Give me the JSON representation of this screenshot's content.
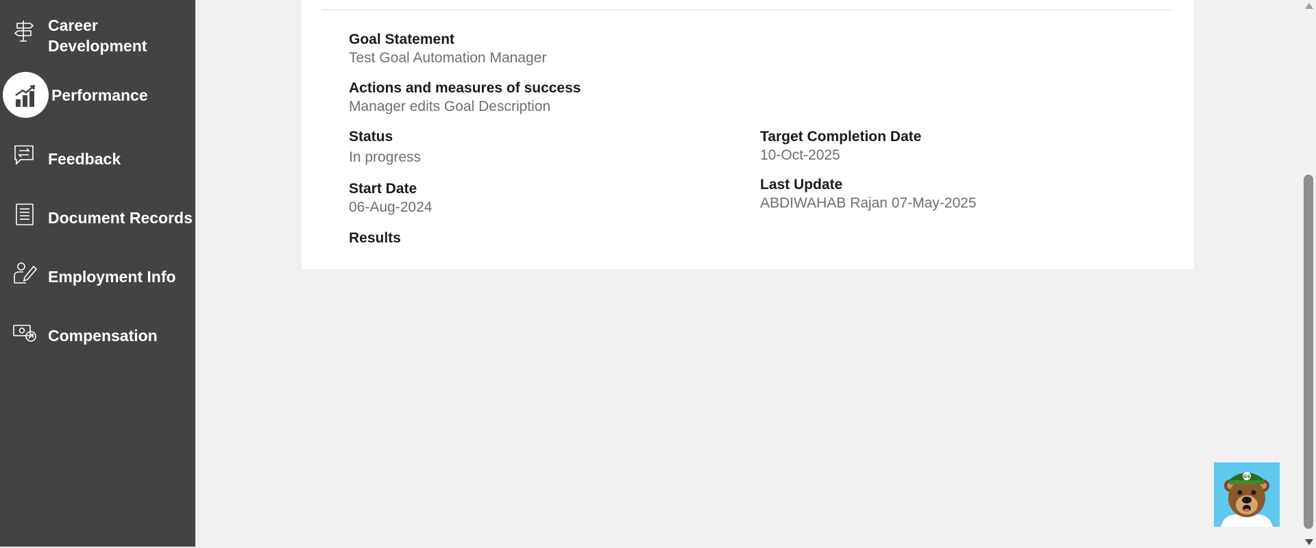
{
  "sidebar": {
    "items": [
      {
        "label_line1": "Career",
        "label_line2": "Development",
        "icon": "signpost-icon"
      },
      {
        "label": "Performance",
        "icon": "bar-chart-up-icon",
        "active": true
      },
      {
        "label": "Feedback",
        "icon": "feedback-icon"
      },
      {
        "label": "Document Records",
        "icon": "document-icon"
      },
      {
        "label": "Employment Info",
        "icon": "person-edit-icon"
      },
      {
        "label": "Compensation",
        "icon": "money-icon"
      }
    ]
  },
  "goal": {
    "statement_label": "Goal Statement",
    "statement_value": "Test Goal Automation Manager",
    "actions_label": "Actions and measures of success",
    "actions_value": "Manager edits Goal Description",
    "status_label": "Status",
    "status_value": "In progress",
    "target_label": "Target Completion Date",
    "target_value": "10-Oct-2025",
    "start_label": "Start Date",
    "start_value": "06-Aug-2024",
    "last_update_label": "Last Update",
    "last_update_value": "ABDIWAHAB Rajan 07-May-2025",
    "results_label": "Results"
  },
  "chatbot": {
    "icon": "bear-mascot-icon"
  },
  "colors": {
    "sidebar_bg": "#434343",
    "page_bg": "#f0f0f0",
    "card_bg": "#ffffff",
    "label_text": "#1a1a1a",
    "value_text": "#6e6e6e",
    "bot_bg": "#5ec8ef"
  }
}
